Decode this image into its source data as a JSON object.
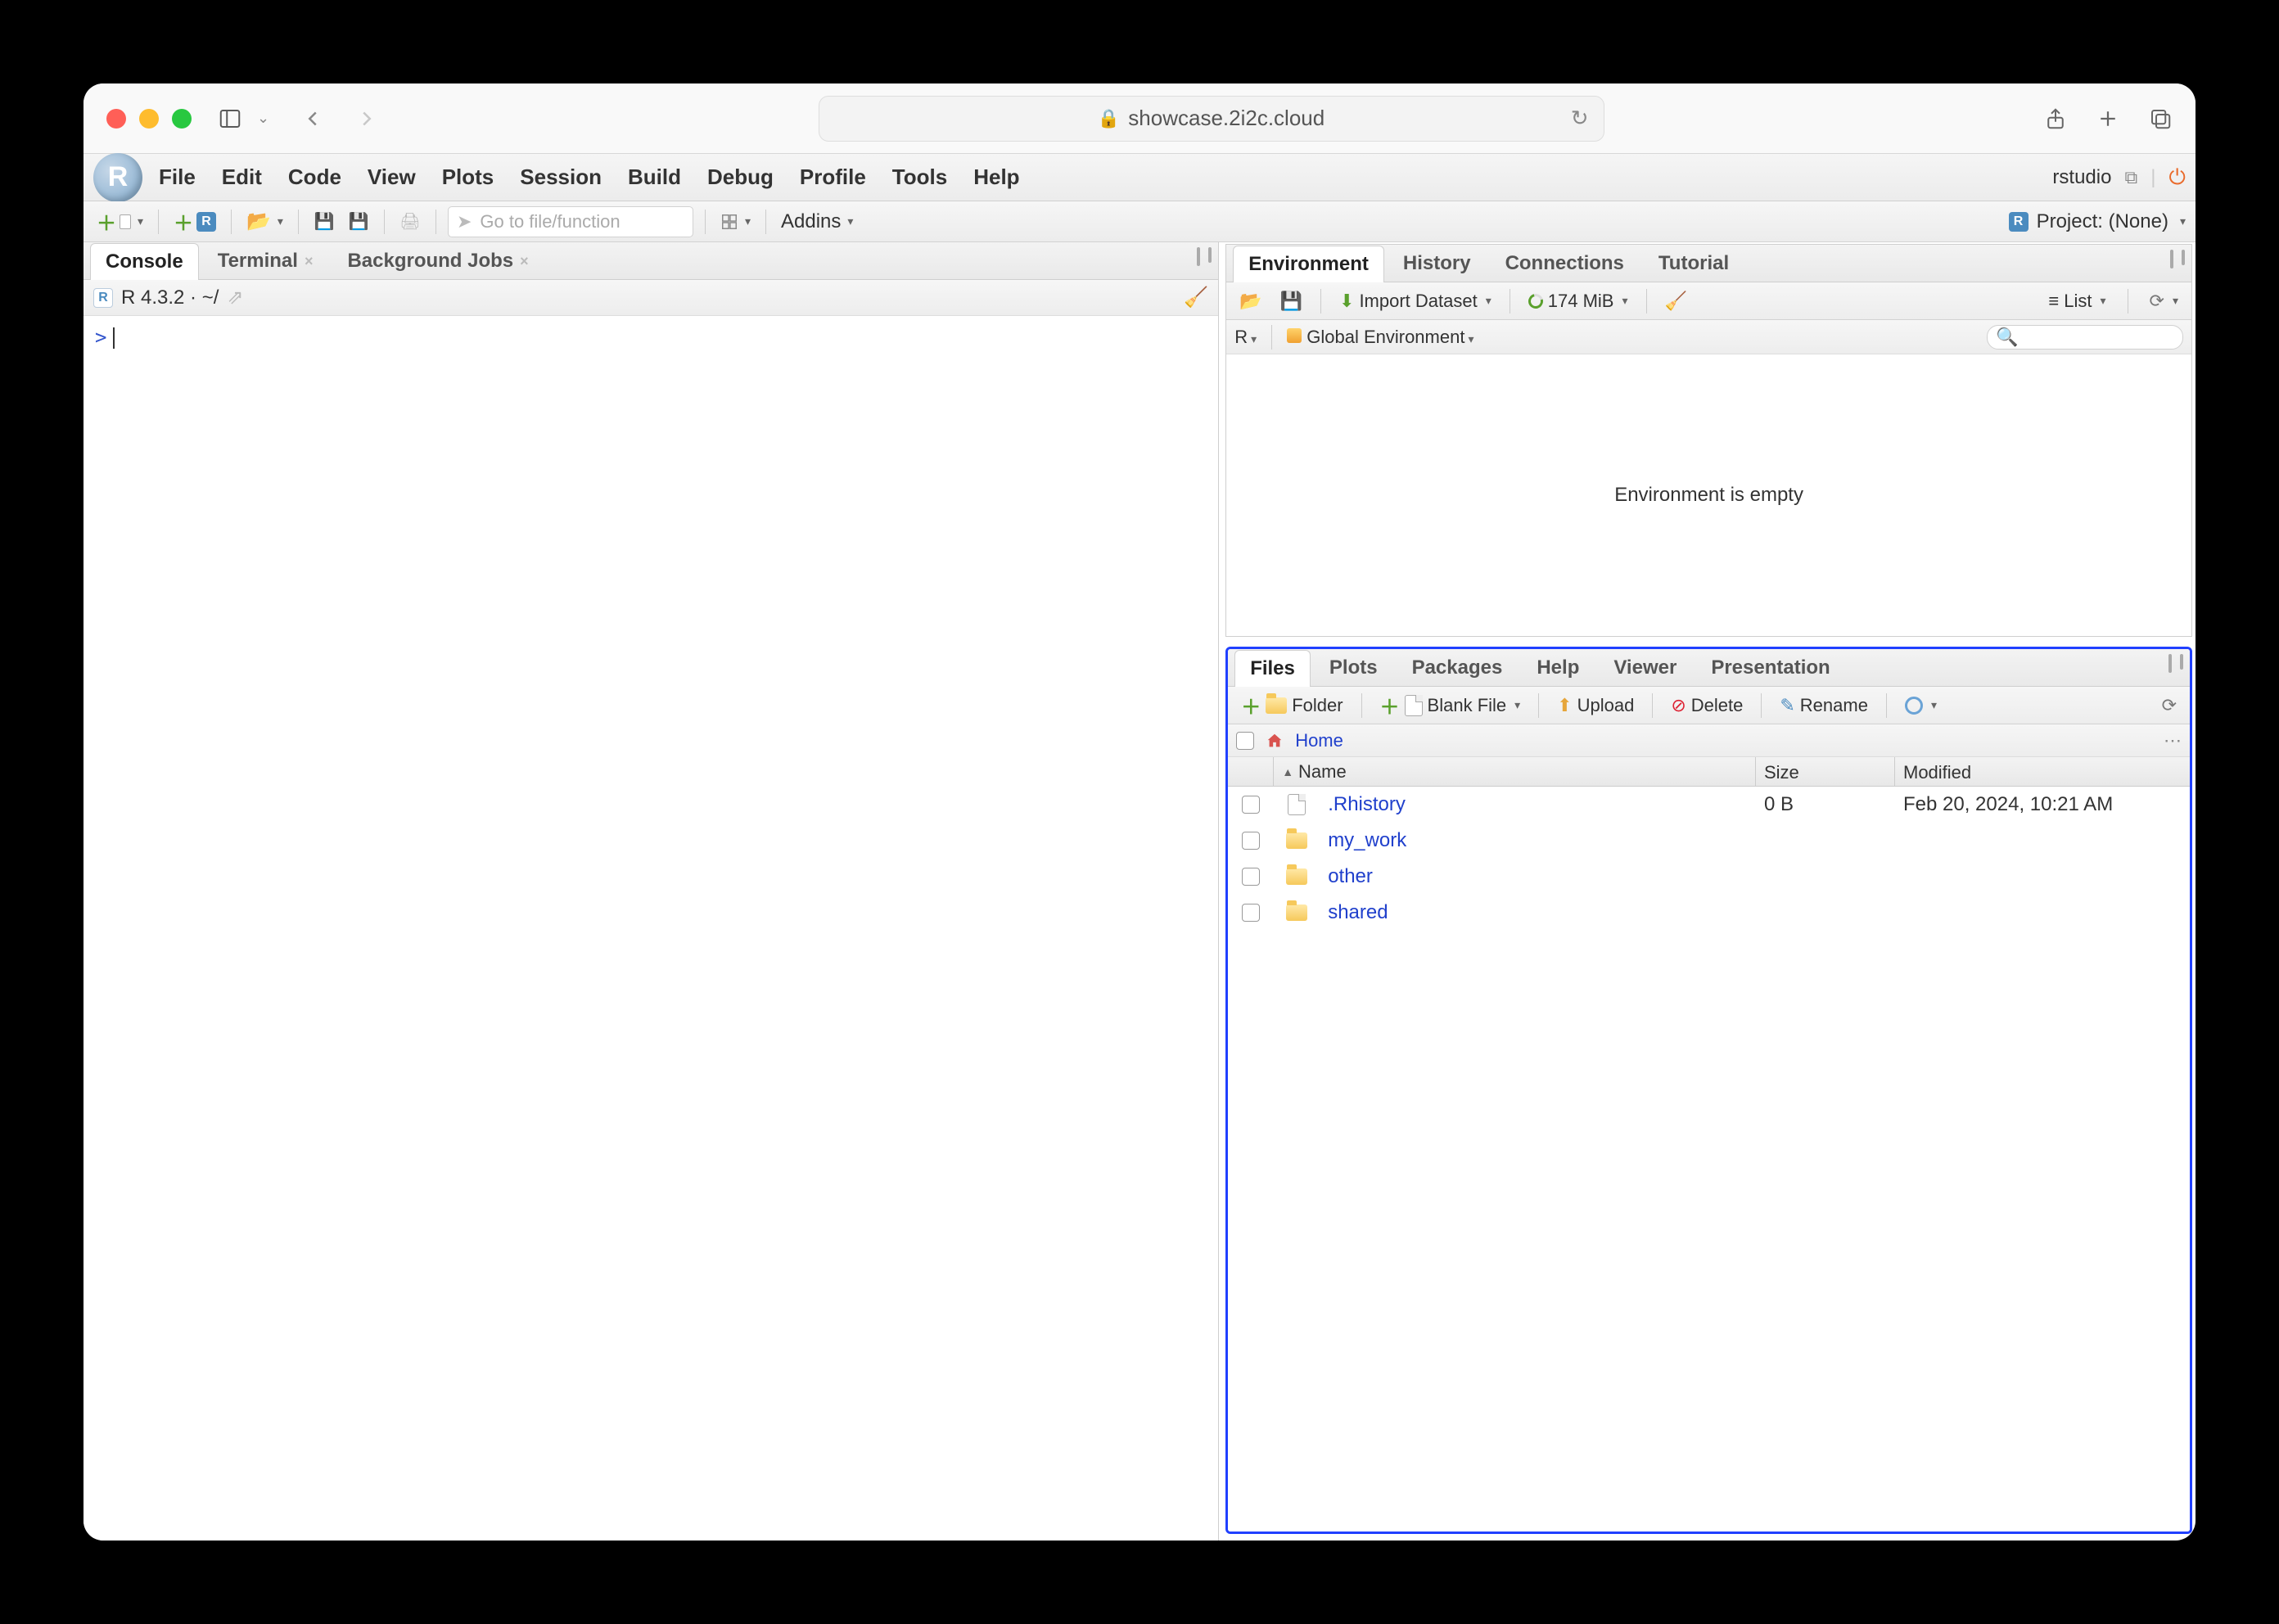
{
  "browser": {
    "url_host": "showcase.2i2c.cloud"
  },
  "rstudio": {
    "brand": "rstudio",
    "logo_letter": "R",
    "menus": [
      "File",
      "Edit",
      "Code",
      "View",
      "Plots",
      "Session",
      "Build",
      "Debug",
      "Profile",
      "Tools",
      "Help"
    ],
    "project_label": "Project: (None)",
    "toolbar": {
      "goto_placeholder": "Go to file/function",
      "addins_label": "Addins"
    }
  },
  "console": {
    "tabs": [
      "Console",
      "Terminal",
      "Background Jobs"
    ],
    "active_tab": 0,
    "version_line": "R 4.3.2 · ~/",
    "prompt": ">"
  },
  "env": {
    "tabs": [
      "Environment",
      "History",
      "Connections",
      "Tutorial"
    ],
    "active_tab": 0,
    "import_label": "Import Dataset",
    "mem_label": "174 MiB",
    "list_label": "List",
    "scope_lang": "R",
    "scope_env": "Global Environment",
    "empty_msg": "Environment is empty"
  },
  "files": {
    "tabs": [
      "Files",
      "Plots",
      "Packages",
      "Help",
      "Viewer",
      "Presentation"
    ],
    "active_tab": 0,
    "toolbar": {
      "folder": "Folder",
      "blank": "Blank File",
      "upload": "Upload",
      "delete": "Delete",
      "rename": "Rename"
    },
    "path_label": "Home",
    "columns": {
      "name": "Name",
      "size": "Size",
      "modified": "Modified"
    },
    "rows": [
      {
        "icon": "file",
        "name": ".Rhistory",
        "size": "0 B",
        "modified": "Feb 20, 2024, 10:21 AM"
      },
      {
        "icon": "folder",
        "name": "my_work",
        "size": "",
        "modified": ""
      },
      {
        "icon": "folder",
        "name": "other",
        "size": "",
        "modified": ""
      },
      {
        "icon": "folder",
        "name": "shared",
        "size": "",
        "modified": ""
      }
    ]
  }
}
